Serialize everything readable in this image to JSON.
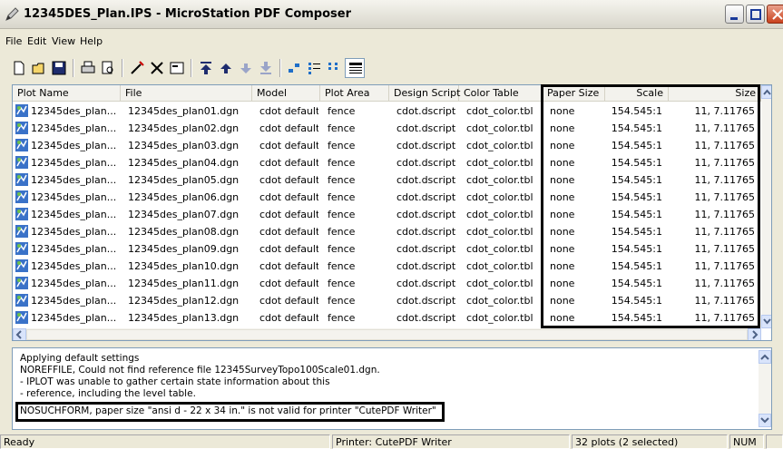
{
  "window": {
    "title": "12345DES_Plan.IPS - MicroStation PDF Composer",
    "icon": "pencil-app-icon"
  },
  "menu": [
    "File",
    "Edit",
    "View",
    "Help"
  ],
  "toolbar": {
    "icons": [
      "new-icon",
      "open-icon",
      "save-icon",
      "print-icon",
      "print-preview-icon",
      "add-files-icon",
      "delete-icon",
      "properties-icon",
      "move-top-icon",
      "move-up-icon",
      "move-down-icon",
      "move-bottom-icon",
      "small-icons-icon",
      "list-view-icon",
      "details-icon",
      "report-view-icon"
    ]
  },
  "table": {
    "columns": [
      "Plot Name",
      "File",
      "Model",
      "Plot Area",
      "Design Script",
      "Color Table",
      "Paper Size",
      "Scale",
      "Size"
    ],
    "rows": [
      [
        "12345des_plan...",
        "12345des_plan01.dgn",
        "cdot default",
        "fence",
        "cdot.dscript",
        "cdot_color.tbl",
        "none",
        "154.545:1",
        "11, 7.11765"
      ],
      [
        "12345des_plan...",
        "12345des_plan02.dgn",
        "cdot default",
        "fence",
        "cdot.dscript",
        "cdot_color.tbl",
        "none",
        "154.545:1",
        "11, 7.11765"
      ],
      [
        "12345des_plan...",
        "12345des_plan03.dgn",
        "cdot default",
        "fence",
        "cdot.dscript",
        "cdot_color.tbl",
        "none",
        "154.545:1",
        "11, 7.11765"
      ],
      [
        "12345des_plan...",
        "12345des_plan04.dgn",
        "cdot default",
        "fence",
        "cdot.dscript",
        "cdot_color.tbl",
        "none",
        "154.545:1",
        "11, 7.11765"
      ],
      [
        "12345des_plan...",
        "12345des_plan05.dgn",
        "cdot default",
        "fence",
        "cdot.dscript",
        "cdot_color.tbl",
        "none",
        "154.545:1",
        "11, 7.11765"
      ],
      [
        "12345des_plan...",
        "12345des_plan06.dgn",
        "cdot default",
        "fence",
        "cdot.dscript",
        "cdot_color.tbl",
        "none",
        "154.545:1",
        "11, 7.11765"
      ],
      [
        "12345des_plan...",
        "12345des_plan07.dgn",
        "cdot default",
        "fence",
        "cdot.dscript",
        "cdot_color.tbl",
        "none",
        "154.545:1",
        "11, 7.11765"
      ],
      [
        "12345des_plan...",
        "12345des_plan08.dgn",
        "cdot default",
        "fence",
        "cdot.dscript",
        "cdot_color.tbl",
        "none",
        "154.545:1",
        "11, 7.11765"
      ],
      [
        "12345des_plan...",
        "12345des_plan09.dgn",
        "cdot default",
        "fence",
        "cdot.dscript",
        "cdot_color.tbl",
        "none",
        "154.545:1",
        "11, 7.11765"
      ],
      [
        "12345des_plan...",
        "12345des_plan10.dgn",
        "cdot default",
        "fence",
        "cdot.dscript",
        "cdot_color.tbl",
        "none",
        "154.545:1",
        "11, 7.11765"
      ],
      [
        "12345des_plan...",
        "12345des_plan11.dgn",
        "cdot default",
        "fence",
        "cdot.dscript",
        "cdot_color.tbl",
        "none",
        "154.545:1",
        "11, 7.11765"
      ],
      [
        "12345des_plan...",
        "12345des_plan12.dgn",
        "cdot default",
        "fence",
        "cdot.dscript",
        "cdot_color.tbl",
        "none",
        "154.545:1",
        "11, 7.11765"
      ],
      [
        "12345des_plan...",
        "12345des_plan13.dgn",
        "cdot default",
        "fence",
        "cdot.dscript",
        "cdot_color.tbl",
        "none",
        "154.545:1",
        "11, 7.11765"
      ]
    ]
  },
  "log": [
    "Applying default settings",
    "NOREFFILE, Could not find reference file 12345SurveyTopo100Scale01.dgn.",
    "- IPLOT was unable to gather certain state information about this",
    "- reference, including the level table.",
    "NOSUCHFORM, paper size \"ansi d - 22 x 34 in.\" is not valid for printer \"CutePDF Writer\""
  ],
  "status": {
    "ready": "Ready",
    "printer": "Printer: CutePDF Writer",
    "plots": "32 plots (2 selected)",
    "num": "NUM"
  },
  "colors": {
    "border": "#7f9db9",
    "chrome": "#ece9d8",
    "highlight": "#000000"
  }
}
